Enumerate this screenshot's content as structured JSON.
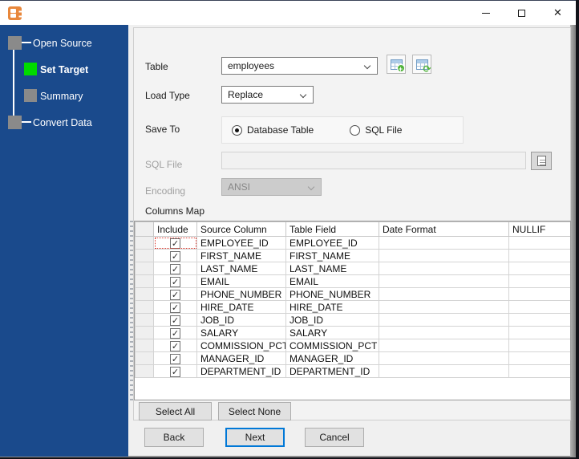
{
  "window": {
    "title": "",
    "controls": {
      "minimize": "minimize",
      "maximize": "maximize",
      "close": "close"
    }
  },
  "sidebar": {
    "steps": [
      {
        "label": "Open Source",
        "state": "done",
        "indent": 0
      },
      {
        "label": "Set Target",
        "state": "active",
        "indent": 1
      },
      {
        "label": "Summary",
        "state": "pending",
        "indent": 1
      },
      {
        "label": "Convert Data",
        "state": "pending",
        "indent": 0
      }
    ]
  },
  "form": {
    "table": {
      "label": "Table",
      "value": "employees"
    },
    "load_type": {
      "label": "Load Type",
      "value": "Replace"
    },
    "save_to": {
      "label": "Save To",
      "options": [
        {
          "label": "Database Table",
          "selected": true
        },
        {
          "label": "SQL File",
          "selected": false
        }
      ]
    },
    "sql_file": {
      "label": "SQL File",
      "value": "",
      "enabled": false
    },
    "encoding": {
      "label": "Encoding",
      "value": "ANSI",
      "enabled": false
    },
    "columns_map_label": "Columns Map"
  },
  "grid": {
    "headers": [
      "",
      "Include",
      "Source Column",
      "Table Field",
      "Date Format",
      "NULLIF"
    ],
    "rows": [
      {
        "include": true,
        "source_column": "EMPLOYEE_ID",
        "table_field": "EMPLOYEE_ID",
        "date_format": "",
        "nullif": ""
      },
      {
        "include": true,
        "source_column": "FIRST_NAME",
        "table_field": "FIRST_NAME",
        "date_format": "",
        "nullif": ""
      },
      {
        "include": true,
        "source_column": "LAST_NAME",
        "table_field": "LAST_NAME",
        "date_format": "",
        "nullif": ""
      },
      {
        "include": true,
        "source_column": "EMAIL",
        "table_field": "EMAIL",
        "date_format": "",
        "nullif": ""
      },
      {
        "include": true,
        "source_column": "PHONE_NUMBER",
        "table_field": "PHONE_NUMBER",
        "date_format": "",
        "nullif": ""
      },
      {
        "include": true,
        "source_column": "HIRE_DATE",
        "table_field": "HIRE_DATE",
        "date_format": "",
        "nullif": ""
      },
      {
        "include": true,
        "source_column": "JOB_ID",
        "table_field": "JOB_ID",
        "date_format": "",
        "nullif": ""
      },
      {
        "include": true,
        "source_column": "SALARY",
        "table_field": "SALARY",
        "date_format": "",
        "nullif": ""
      },
      {
        "include": true,
        "source_column": "COMMISSION_PCT",
        "table_field": "COMMISSION_PCT",
        "date_format": "",
        "nullif": ""
      },
      {
        "include": true,
        "source_column": "MANAGER_ID",
        "table_field": "MANAGER_ID",
        "date_format": "",
        "nullif": ""
      },
      {
        "include": true,
        "source_column": "DEPARTMENT_ID",
        "table_field": "DEPARTMENT_ID",
        "date_format": "",
        "nullif": ""
      }
    ],
    "focused_cell": {
      "row": 0,
      "column": "Include"
    }
  },
  "buttons": {
    "select_all": "Select All",
    "select_none": "Select None",
    "back": "Back",
    "next": "Next",
    "cancel": "Cancel"
  },
  "icons": {
    "minimize-icon": "–",
    "maximize-icon": "▢",
    "close-icon": "✕",
    "chevron-down-icon": "⌄",
    "add-table-icon": "table-with-plus",
    "refresh-table-icon": "table-with-refresh",
    "browse-file-icon": "document",
    "checkbox-checked-icon": "✓",
    "radio-selected-icon": "●"
  },
  "colors": {
    "sidebar_bg": "#1A4A8C",
    "active_step_green": "#00DB00",
    "pending_step_gray": "#8A8A8A",
    "next_button_border": "#0078D7",
    "app_icon_orange": "#E8873B",
    "focus_cell_red": "#DD3B30"
  }
}
